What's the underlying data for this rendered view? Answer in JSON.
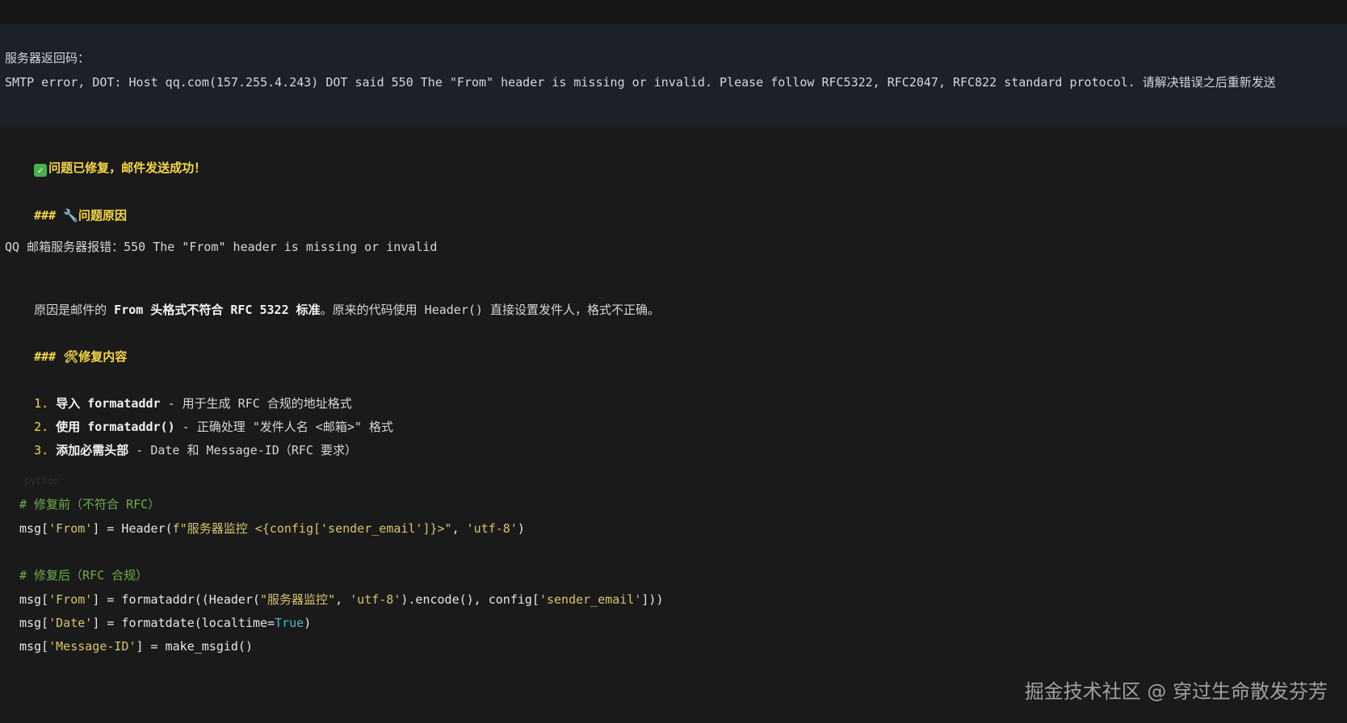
{
  "error": {
    "label": "服务器返回码：",
    "message": "SMTP error, DOT: Host qq.com(157.255.4.243) DOT said 550 The \"From\" header is missing or invalid. Please follow RFC5322, RFC2047, RFC822 standard protocol. 请解决错误之后重新发送"
  },
  "status": {
    "icon": "check-icon",
    "text": "问题已修复，邮件发送成功！"
  },
  "cause": {
    "heading_marker": "###",
    "heading_icon": "🔧",
    "heading": "问题原因",
    "line1": "QQ 邮箱服务器报错：550 The \"From\" header is missing or invalid",
    "line2_prefix": "原因是邮件的 ",
    "line2_bold": "From 头格式不符合 RFC 5322 标准",
    "line2_suffix": "。原来的代码使用 Header() 直接设置发件人，格式不正确。"
  },
  "fix": {
    "heading_marker": "###",
    "heading_icon": "🛠",
    "heading": "修复内容",
    "items": [
      {
        "num": "1.",
        "bold": "导入 formataddr",
        "rest": " - 用于生成 RFC 合规的地址格式"
      },
      {
        "num": "2.",
        "bold": "使用 formataddr()",
        "rest": " - 正确处理 \"发件人名 <邮箱>\" 格式"
      },
      {
        "num": "3.",
        "bold": "添加必需头部",
        "rest": " - Date 和 Message-ID（RFC 要求）"
      }
    ]
  },
  "code": {
    "lang": "python",
    "comment_before": "# 修复前（不符合 RFC）",
    "before": {
      "a": "msg[",
      "k": "'From'",
      "b": "] = Header(",
      "s1": "f\"服务器监控 <{config['sender_email']}>\"",
      "c": ", ",
      "s2": "'utf-8'",
      "d": ")"
    },
    "comment_after": "# 修复后（RFC 合规）",
    "after1": {
      "a": "msg[",
      "k": "'From'",
      "b": "] = formataddr((Header(",
      "s1": "\"服务器监控\"",
      "c": ", ",
      "s2": "'utf-8'",
      "d": ").encode(), config[",
      "s3": "'sender_email'",
      "e": "]))"
    },
    "after2": {
      "a": "msg[",
      "k": "'Date'",
      "b": "] = formatdate(localtime=",
      "kw": "True",
      "c": ")"
    },
    "after3": {
      "a": "msg[",
      "k": "'Message-ID'",
      "b": "] = make_msgid()"
    }
  },
  "watermark": "掘金技术社区 @ 穿过生命散发芬芳"
}
